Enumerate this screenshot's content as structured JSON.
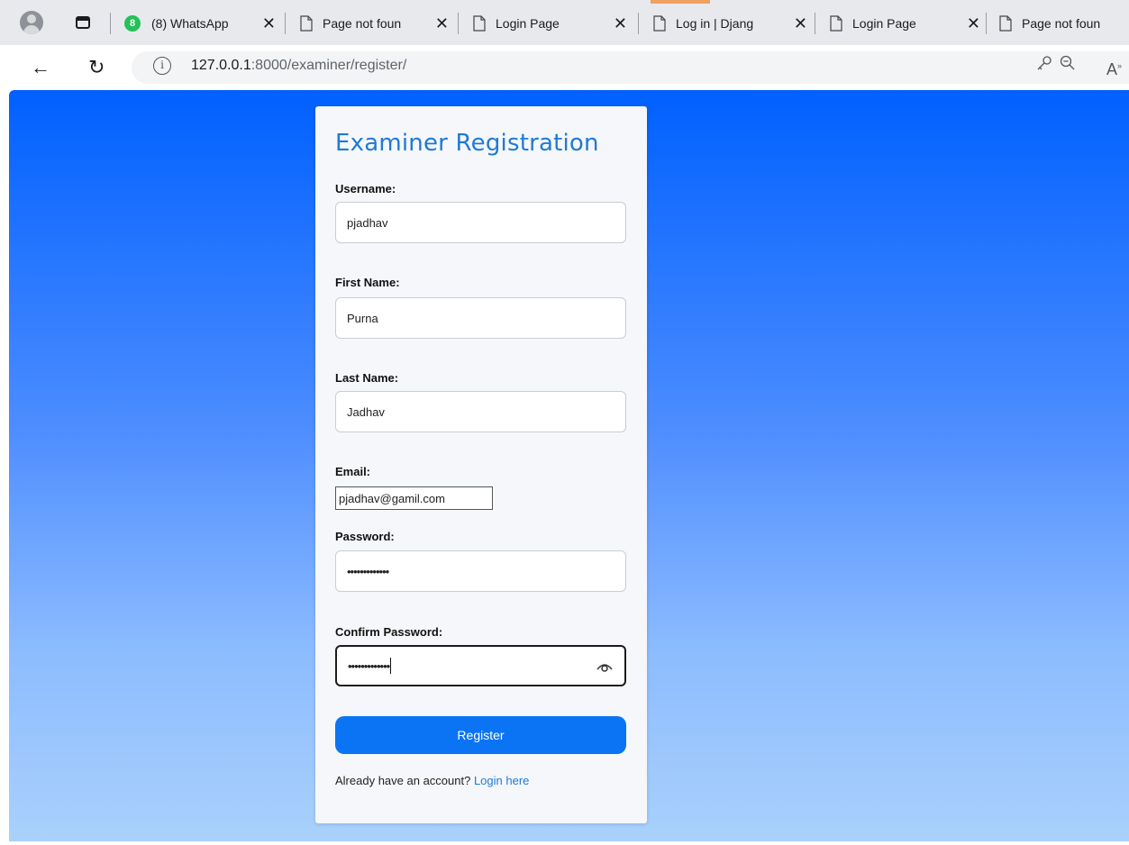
{
  "browser": {
    "tabs": [
      {
        "title": "(8) WhatsApp",
        "badge": "8"
      },
      {
        "title": "Page not foun"
      },
      {
        "title": "Login Page"
      },
      {
        "title": "Log in | Djang"
      },
      {
        "title": "Login Page"
      },
      {
        "title": "Page not foun"
      }
    ],
    "url_host": "127.0.0.1",
    "url_path": ":8000/examiner/register/"
  },
  "form": {
    "title": "Examiner Registration",
    "username_label": "Username:",
    "username_value": "pjadhav",
    "first_name_label": "First Name:",
    "first_name_value": "Purna",
    "last_name_label": "Last Name:",
    "last_name_value": "Jadhav",
    "email_label": "Email:",
    "email_value": "pjadhav@gamil.com",
    "password_label": "Password:",
    "password_value": "•••••••••••••",
    "confirm_label": "Confirm Password:",
    "confirm_value": "•••••••••••••",
    "submit_label": "Register",
    "footer_text": "Already have an account? ",
    "footer_link": "Login here"
  },
  "colors": {
    "accent": "#1f7ad6",
    "button": "#0a74f5",
    "gradient_top": "#0060ff",
    "gradient_bottom": "#a9d1fb"
  }
}
